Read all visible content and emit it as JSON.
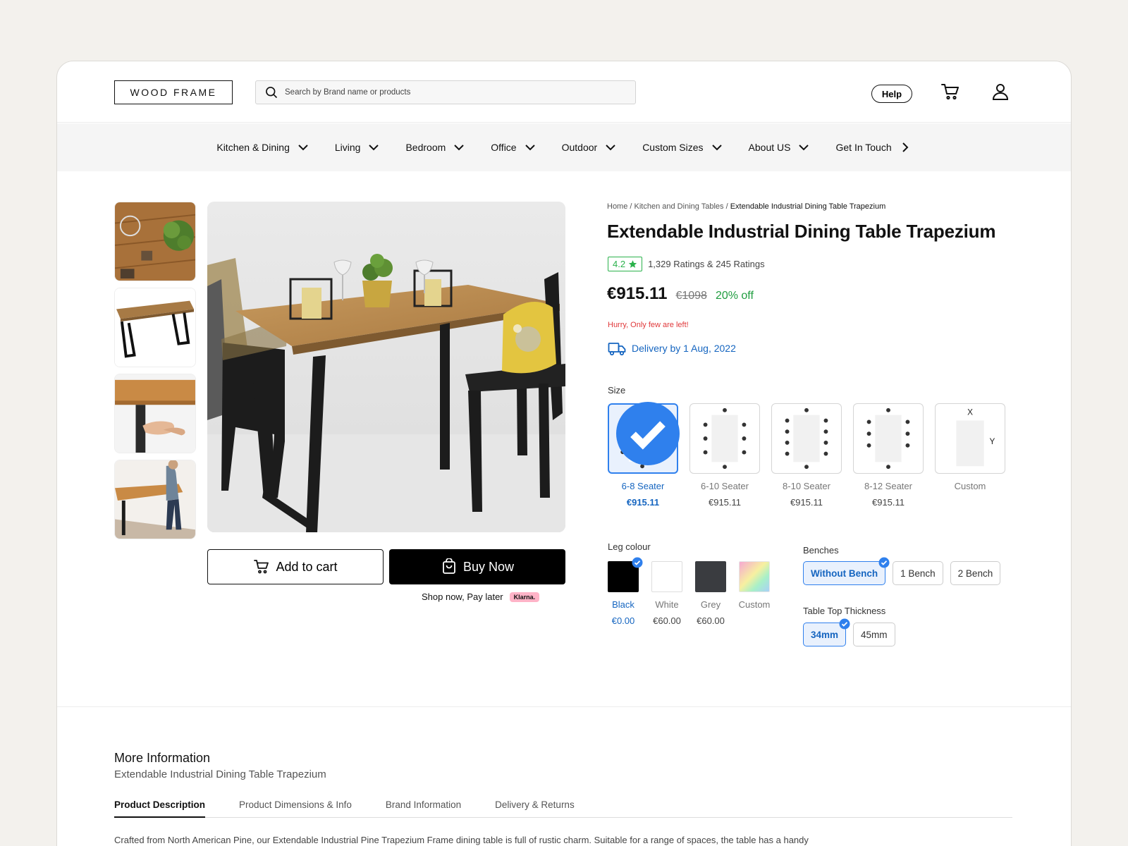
{
  "header": {
    "logo": "WOOD FRAME",
    "search_placeholder": "Search by Brand name or products",
    "help_label": "Help"
  },
  "nav": {
    "items": [
      {
        "label": "Kitchen & Dining",
        "icon": "chevron-down-icon"
      },
      {
        "label": "Living",
        "icon": "chevron-down-icon"
      },
      {
        "label": "Bedroom",
        "icon": "chevron-down-icon"
      },
      {
        "label": "Office",
        "icon": "chevron-down-icon"
      },
      {
        "label": "Outdoor",
        "icon": "chevron-down-icon"
      },
      {
        "label": "Custom Sizes",
        "icon": "chevron-down-icon"
      },
      {
        "label": "About US",
        "icon": "chevron-down-icon"
      },
      {
        "label": "Get In Touch",
        "icon": "chevron-right-icon"
      }
    ]
  },
  "breadcrumb": {
    "home": "Home",
    "category": "Kitchen and Dining Tables",
    "current": "Extendable Industrial Dining Table Trapezium",
    "separator": "/"
  },
  "product": {
    "title": "Extendable Industrial Dining Table Trapezium",
    "rating": "4.2",
    "rating_count": "1,329 Ratings & 245 Ratings",
    "price": "€915.11",
    "mrp": "€1098",
    "discount": "20% off",
    "stock_note": "Hurry, Only few are left!",
    "delivery": "Delivery by 1 Aug, 2022"
  },
  "actions": {
    "add_to_cart": "Add to cart",
    "buy_now": "Buy Now",
    "pay_later": "Shop now, Pay later",
    "klarna": "Klarna."
  },
  "size": {
    "label": "Size",
    "options": [
      {
        "name": "6-8 Seater",
        "price": "€915.11",
        "selected": true
      },
      {
        "name": "6-10 Seater",
        "price": "€915.11",
        "selected": false
      },
      {
        "name": "8-10 Seater",
        "price": "€915.11",
        "selected": false
      },
      {
        "name": "8-12 Seater",
        "price": "€915.11",
        "selected": false
      },
      {
        "name": "Custom",
        "price": "",
        "selected": false,
        "x_label": "X",
        "y_label": "Y"
      }
    ]
  },
  "leg_colour": {
    "label": "Leg colour",
    "options": [
      {
        "name": "Black",
        "price": "€0.00",
        "color": "#000000",
        "selected": true
      },
      {
        "name": "White",
        "price": "€60.00",
        "color": "#ffffff",
        "selected": false
      },
      {
        "name": "Grey",
        "price": "€60.00",
        "color": "#3a3c40",
        "selected": false
      },
      {
        "name": "Custom",
        "price": "",
        "color": "gradient",
        "selected": false
      }
    ]
  },
  "benches": {
    "label": "Benches",
    "options": [
      {
        "label": "Without Bench",
        "selected": true
      },
      {
        "label": "1 Bench",
        "selected": false
      },
      {
        "label": "2 Bench",
        "selected": false
      }
    ]
  },
  "thickness": {
    "label": "Table Top Thickness",
    "options": [
      {
        "label": "34mm",
        "selected": true
      },
      {
        "label": "45mm",
        "selected": false
      }
    ]
  },
  "more_info": {
    "title": "More Information",
    "subtitle": "Extendable Industrial Dining Table Trapezium",
    "tabs": [
      {
        "label": "Product Description",
        "active": true
      },
      {
        "label": "Product Dimensions & Info",
        "active": false
      },
      {
        "label": "Brand Information",
        "active": false
      },
      {
        "label": "Delivery & Returns",
        "active": false
      }
    ],
    "description": "Crafted from North American Pine, our Extendable Industrial Pine Trapezium Frame dining table is full of rustic charm. Suitable for a range of spaces, the table has a handy"
  },
  "colors": {
    "accent": "#2f80ed",
    "link": "#1565c0",
    "success": "#1f9d3f",
    "danger": "#e0383a"
  }
}
